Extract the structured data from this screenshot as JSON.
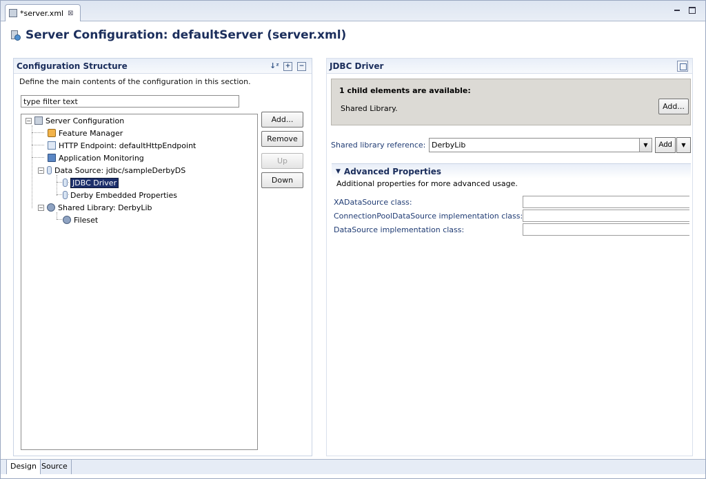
{
  "editor": {
    "tab_label": "*server.xml",
    "tab_close": "⊠"
  },
  "header": {
    "title": "Server Configuration: defaultServer (server.xml)"
  },
  "left": {
    "title": "Configuration Structure",
    "description": "Define the main contents of the configuration in this section.",
    "filter_value": "type filter text",
    "tree": [
      {
        "label": "Server Configuration",
        "icon": "server-icon",
        "twisty": "−"
      },
      {
        "label": "Feature Manager",
        "icon": "feature-manager-icon"
      },
      {
        "label": "HTTP Endpoint: defaultHttpEndpoint",
        "icon": "http-endpoint-icon"
      },
      {
        "label": "Application Monitoring",
        "icon": "monitor-icon"
      },
      {
        "label": "Data Source: jdbc/sampleDerbyDS",
        "icon": "datasource-icon",
        "twisty": "−"
      },
      {
        "label": "JDBC Driver",
        "icon": "jdbc-driver-icon",
        "selected": true
      },
      {
        "label": "Derby Embedded Properties",
        "icon": "properties-icon"
      },
      {
        "label": "Shared Library: DerbyLib",
        "icon": "library-icon",
        "twisty": "−"
      },
      {
        "label": "Fileset",
        "icon": "fileset-icon"
      }
    ],
    "buttons": {
      "add": "Add...",
      "remove": "Remove",
      "up": "Up",
      "down": "Down"
    }
  },
  "right": {
    "title": "JDBC Driver",
    "children_title": "1 child elements are available:",
    "children_item": "Shared Library.",
    "children_add": "Add...",
    "shared_lib_label": "Shared library reference:",
    "shared_lib_value": "DerbyLib",
    "shared_lib_add": "Add",
    "advanced": {
      "title": "Advanced Properties",
      "description": "Additional properties for more advanced usage.",
      "fields": [
        {
          "label": "XADataSource class:",
          "value": ""
        },
        {
          "label": "ConnectionPoolDataSource implementation class:",
          "value": ""
        },
        {
          "label": "DataSource implementation class:",
          "value": ""
        }
      ]
    }
  },
  "bottom_tabs": [
    "Design",
    "Source"
  ]
}
